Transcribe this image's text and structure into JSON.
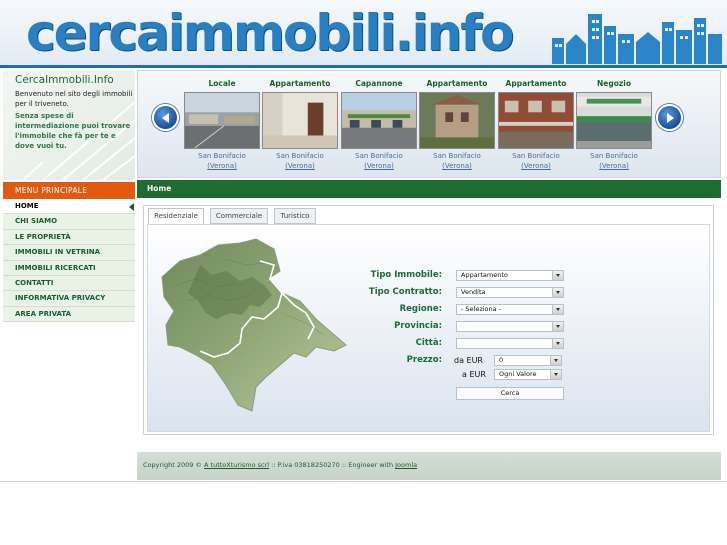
{
  "header": {
    "logo_text": "cercaimmobili.info"
  },
  "intro": {
    "site_name": "CercaImmobili.Info",
    "line1": "Benvenuto nel sito degli immobili per il triveneto.",
    "line2": "Senza spese di intermediazione puoi trovare l'immobile che fà per te e dove vuoi tu."
  },
  "menu": {
    "header": "MENU PRINCIPALE",
    "items": [
      {
        "label": "HOME"
      },
      {
        "label": "CHI SIAMO"
      },
      {
        "label": "LE PROPRIETÀ"
      },
      {
        "label": "IMMOBILI IN VETRINA"
      },
      {
        "label": "IMMOBILI RICERCATI"
      },
      {
        "label": "CONTATTI"
      },
      {
        "label": "INFORMATIVA PRIVACY"
      },
      {
        "label": "AREA PRIVATA"
      }
    ]
  },
  "carousel": {
    "cards": [
      {
        "type": "Locale",
        "city": "San Bonifacio",
        "province": "(Verona)"
      },
      {
        "type": "Appartamento",
        "city": "San Bonifacio",
        "province": "(Verona)"
      },
      {
        "type": "Capannone",
        "city": "San Bonifacio",
        "province": "(Verona)"
      },
      {
        "type": "Appartamento",
        "city": "San Bonifacio",
        "province": "(Verona)"
      },
      {
        "type": "Appartamento",
        "city": "San Bonifacio",
        "province": "(Verona)"
      },
      {
        "type": "Negozio",
        "city": "San Bonifacio",
        "province": "(Verona)"
      }
    ]
  },
  "breadcrumb": "Home",
  "tabs": [
    "Residenziale",
    "Commerciale",
    "Turistico"
  ],
  "form": {
    "tipo_immobile_label": "Tipo Immobile:",
    "tipo_immobile_value": "Appartamento",
    "tipo_contratto_label": "Tipo Contratto:",
    "tipo_contratto_value": "Vendita",
    "regione_label": "Regione:",
    "regione_value": "- Seleziona -",
    "provincia_label": "Provincia:",
    "provincia_value": "",
    "citta_label": "Città:",
    "citta_value": "",
    "prezzo_label": "Prezzo:",
    "da_label": "da EUR",
    "da_value": "0",
    "a_label": "a EUR",
    "a_value": "Ogni Valore",
    "submit_label": "Cerca"
  },
  "footer": {
    "copyright": "Copyright 2009 © ",
    "company_link": "A tuttoXturismo scrl",
    "piva": " :: P.iva 03818250270 :: Engineer with ",
    "joomla_link": "Joomla"
  },
  "colors": {
    "brand_blue": "#2a7fc0",
    "menu_orange": "#e15a12",
    "bar_green": "#1f6b32",
    "label_green": "#1b6a3b"
  }
}
